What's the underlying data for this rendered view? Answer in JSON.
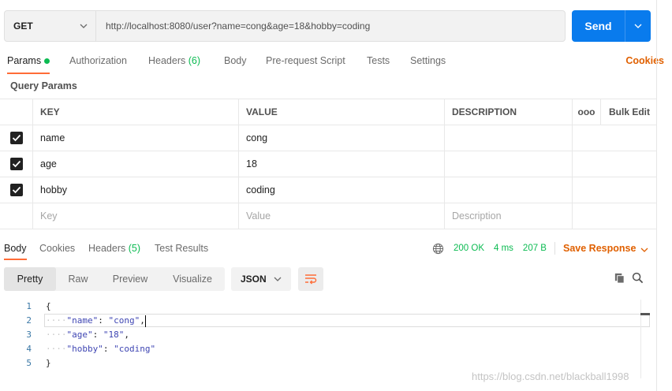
{
  "request": {
    "method": "GET",
    "url": "http://localhost:8080/user?name=cong&age=18&hobby=coding",
    "send_label": "Send"
  },
  "request_tabs": {
    "params": "Params",
    "authorization": "Authorization",
    "headers": "Headers",
    "headers_count": "(6)",
    "body": "Body",
    "pre_request": "Pre-request Script",
    "tests": "Tests",
    "settings": "Settings",
    "cookies": "Cookies"
  },
  "query_params": {
    "title": "Query Params",
    "columns": {
      "key": "KEY",
      "value": "VALUE",
      "description": "DESCRIPTION",
      "more": "ooo",
      "bulk_edit": "Bulk Edit"
    },
    "rows": [
      {
        "key": "name",
        "value": "cong",
        "checked": true
      },
      {
        "key": "age",
        "value": "18",
        "checked": true
      },
      {
        "key": "hobby",
        "value": "coding",
        "checked": true
      }
    ],
    "placeholder": {
      "key": "Key",
      "value": "Value",
      "description": "Description"
    }
  },
  "response_tabs": {
    "body": "Body",
    "cookies": "Cookies",
    "headers": "Headers",
    "headers_count": "(5)",
    "test_results": "Test Results"
  },
  "status": {
    "code": "200 OK",
    "time": "4 ms",
    "size": "207 B",
    "save_response": "Save Response"
  },
  "view_modes": {
    "pretty": "Pretty",
    "raw": "Raw",
    "preview": "Preview",
    "visualize": "Visualize",
    "format": "JSON"
  },
  "editor": {
    "line_numbers": [
      "1",
      "2",
      "3",
      "4",
      "5"
    ],
    "open_brace": "{",
    "close_brace": "}",
    "fields": [
      {
        "key": "\"name\"",
        "value": "\"cong\"",
        "sep": ": ",
        "trail": ","
      },
      {
        "key": "\"age\"",
        "value": "\"18\"",
        "sep": ": ",
        "trail": ","
      },
      {
        "key": "\"hobby\"",
        "value": "\"coding\"",
        "sep": ": ",
        "trail": ""
      }
    ]
  },
  "watermark": "https://blog.csdn.net/blackball1998",
  "colors": {
    "accent": "#ff6c37",
    "send": "#097bed",
    "success": "#0cbb52",
    "link": "#e06000"
  }
}
